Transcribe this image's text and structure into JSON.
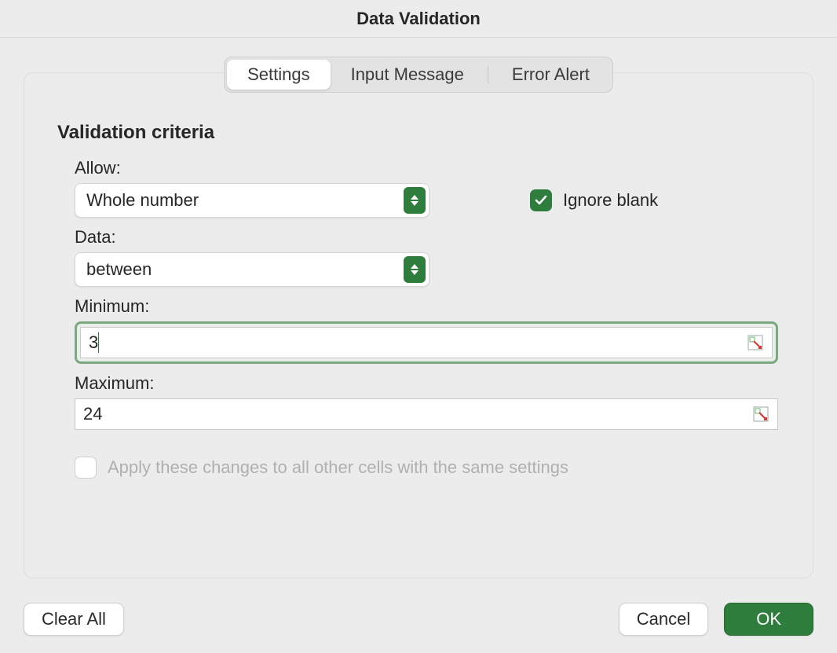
{
  "title": "Data Validation",
  "tabs": {
    "settings": "Settings",
    "input_message": "Input Message",
    "error_alert": "Error Alert"
  },
  "section_heading": "Validation criteria",
  "labels": {
    "allow": "Allow:",
    "data": "Data:",
    "minimum": "Minimum:",
    "maximum": "Maximum:"
  },
  "fields": {
    "allow_value": "Whole number",
    "data_value": "between",
    "minimum_value": "3",
    "maximum_value": "24"
  },
  "checkboxes": {
    "ignore_blank_label": "Ignore blank",
    "ignore_blank_checked": true,
    "apply_all_label": "Apply these changes to all other cells with the same settings",
    "apply_all_checked": false
  },
  "buttons": {
    "clear_all": "Clear All",
    "cancel": "Cancel",
    "ok": "OK"
  }
}
